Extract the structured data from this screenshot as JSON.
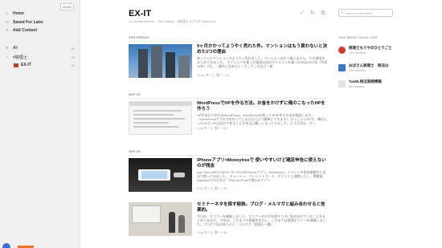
{
  "sidebar": {
    "unpin_label": "Unpin",
    "items": [
      {
        "label": "Home",
        "icon": "home-icon"
      },
      {
        "label": "Saved For Later",
        "icon": "bookmark-icon"
      },
      {
        "label": "Add Content",
        "icon": "plus-icon"
      }
    ],
    "categories": [
      {
        "label": "All",
        "count": "88"
      },
      {
        "label": "#税理士",
        "count": "88"
      }
    ],
    "feeds": [
      {
        "label": "EX-IT",
        "count": "88"
      }
    ]
  },
  "feed": {
    "title": "EX-IT",
    "meta": "10 unread articles · 706 readers · #税理士 #ブログ #Network"
  },
  "toolbar": {
    "icons": [
      "check-icon",
      "refresh-icon",
      "gear-icon"
    ]
  },
  "sections": [
    {
      "label": "YESTERDAY"
    },
    {
      "label": "SEP 29"
    },
    {
      "label": "SEP 28"
    }
  ],
  "articles": [
    {
      "title": "9ヶ月かかってようやく売れた件。マンションはもう買わないと決めた3つの理由",
      "snippet": "持っていたマンションがようやく売れました。マンションはもう買いません。その理由をまとめてみました。 マンションを買った理由は自分マンションを買ったのは2007年（平成19年）2月。・都内に住みたい・そこそこの広さ・新",
      "meta": "10 by 井ノ上 陽一 / 1d"
    },
    {
      "title": "WordPressでHPを作る方法。お金をかけずに俺のこもったHPを作ろう",
      "snippet": "HPを自分で作れるWordPress。WordPressを使ってHPを作る方法を解説します。（WordPressでブログを作っている方ならより簡単にできます） かっこいいHPか、俺の入ったHPか HPは自分で作ることが本当に難しくなってきました。より大切な、かっ",
      "meta": "1 by 井ノ上 陽一 / 2d"
    },
    {
      "title": "iPhoneアプリ×Moneytreeで 使いやすいけど確定申告に使えないのが残念",
      "snippet": "App Store BEST BEST OF 2013のiPhoneアプリ、Moneytree。イベントを参加者数比に自分で使ってみました。 キャッシュ、クレジットカード、ポイントと連動したし、素敵者AppStoreで行われた「iPhone?iPadで使わるアプリ",
      "meta": "9 by 井ノ上 陽一 / 3d"
    },
    {
      "title": "セミナーネタを探す秘訣。ブログ・メルマガと組み合わせると効果的。",
      "snippet": "今日は、セミナーを開催しました。セミナーのネタを探すときに私を自分でいることをまとめてみます。 今年は、これまでの経験を生かし、これまでは経理セミナーを開催しました。ブログではお知らせに、メルマガ「税理士一顧」",
      "meta": "1 by 井ノ上 陽一 / 3d"
    }
  ],
  "search": {
    "placeholder": "search or add feed"
  },
  "recommendations": {
    "heading": "YOU MIGHT ALSO LIKE",
    "items": [
      {
        "title": "税理士もりやのひとりごと",
        "sub": "219 readers",
        "logo": "logo-red-icon"
      },
      {
        "title": "おばさん税理士　税法は",
        "sub": "264 readers",
        "logo": "logo-blue-icon"
      },
      {
        "title": "TaxML税法実務情報",
        "sub": "80 readers",
        "logo": "logo-gray-icon"
      }
    ]
  }
}
